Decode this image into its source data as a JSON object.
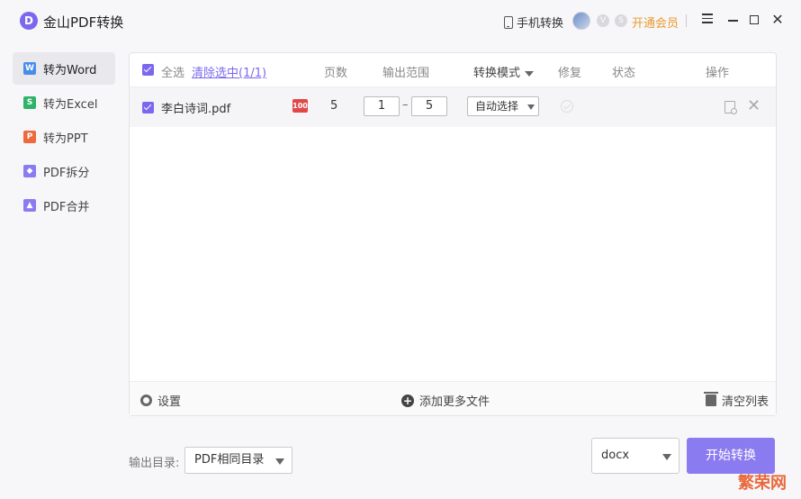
{
  "app": {
    "logo_letter": "D",
    "title": "金山PDF转换"
  },
  "titlebar": {
    "phone_convert": "手机转换",
    "vip": "开通会员",
    "badge_a": "V",
    "badge_b": "S",
    "close": "✕"
  },
  "sidebar": {
    "items": [
      {
        "label": "转为Word",
        "icon": "W",
        "color": "#4a8de8",
        "active": true
      },
      {
        "label": "转为Excel",
        "icon": "S",
        "color": "#2fb36a",
        "active": false
      },
      {
        "label": "转为PPT",
        "icon": "P",
        "color": "#ec6a3b",
        "active": false
      },
      {
        "label": "PDF拆分",
        "icon": "◆",
        "color": "#8a7cf0",
        "active": false
      },
      {
        "label": "PDF合并",
        "icon": "▲",
        "color": "#8a7cf0",
        "active": false
      }
    ]
  },
  "table": {
    "headers": {
      "select_all": "全选",
      "clear_selected": "清除选中(1/1)",
      "pages": "页数",
      "range": "输出范围",
      "mode": "转换模式",
      "repair": "修复",
      "status": "状态",
      "actions": "操作"
    },
    "rows": [
      {
        "filename": "李白诗词.pdf",
        "badge": "100",
        "pages": "5",
        "range_from": "1",
        "range_dash": "–",
        "range_to": "5",
        "mode": "自动选择"
      }
    ]
  },
  "footer": {
    "settings": "设置",
    "add_more": "添加更多文件",
    "clear_list": "清空列表"
  },
  "bottom": {
    "output_label": "输出目录:",
    "output_dir": "PDF相同目录",
    "format": "docx",
    "start": "开始转换"
  },
  "watermark": "繁荣网"
}
